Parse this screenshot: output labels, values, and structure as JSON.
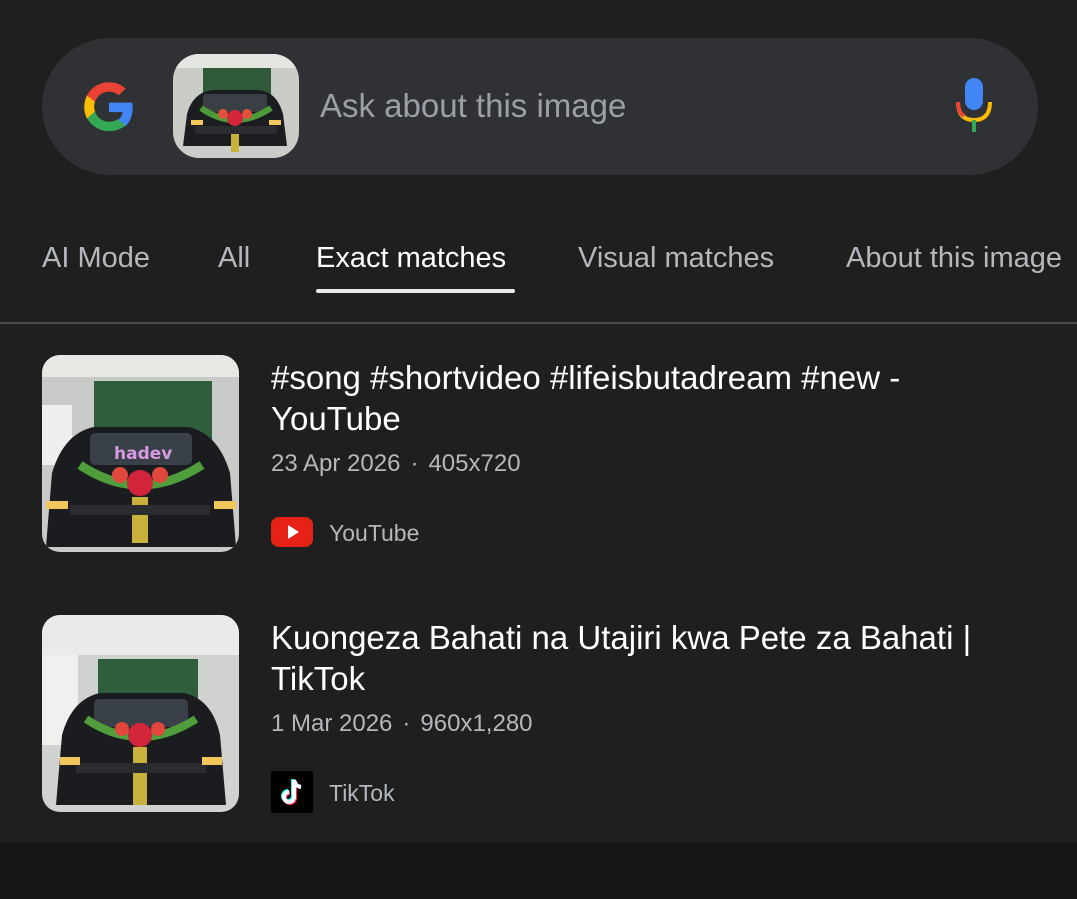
{
  "search": {
    "placeholder": "Ask about this image",
    "logo_icon": "google-g-icon",
    "mic_icon": "microphone-icon"
  },
  "tabs": [
    {
      "label": "AI Mode",
      "active": false
    },
    {
      "label": "All",
      "active": false
    },
    {
      "label": "Exact matches",
      "active": true
    },
    {
      "label": "Visual matches",
      "active": false
    },
    {
      "label": "About this image",
      "active": false
    }
  ],
  "results": [
    {
      "title": "#song #shortvideo #lifeisbutadream #new - YouTube",
      "date": "23 Apr 2026",
      "dimensions": "405x720",
      "source": "YouTube",
      "source_icon": "youtube-icon",
      "thumb_overlay_text": "hadev"
    },
    {
      "title": "Kuongeza Bahati na Utajiri kwa Pete za Bahati | TikTok",
      "date": "1 Mar 2026",
      "dimensions": "960x1,280",
      "source": "TikTok",
      "source_icon": "tiktok-icon"
    }
  ],
  "colors": {
    "background": "#1f1f1f",
    "searchbar": "#303134",
    "youtube_red": "#e62117"
  }
}
